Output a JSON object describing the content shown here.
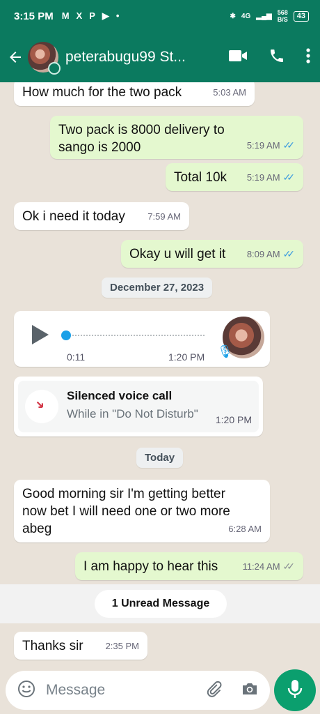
{
  "status_bar": {
    "time": "3:15 PM",
    "notification_icons": [
      "M",
      "X",
      "P",
      "▶",
      "•"
    ],
    "signal": "4G",
    "data_rate": "568",
    "data_unit": "B/S",
    "battery": "43"
  },
  "header": {
    "contact_name": "peterabugu99 St...",
    "icons": [
      "back-arrow-icon",
      "video-call-icon",
      "phone-icon",
      "more-vert-icon"
    ]
  },
  "messages": [
    {
      "direction": "in",
      "text": "How much for the two pack",
      "time": "5:03 AM"
    },
    {
      "direction": "out",
      "text": "Two pack is 8000 delivery to sango is 2000",
      "time": "5:19 AM",
      "read": true
    },
    {
      "direction": "out",
      "text": "Total 10k",
      "time": "5:19 AM",
      "read": true
    },
    {
      "direction": "in",
      "text": "Ok i need it today",
      "time": "7:59 AM"
    },
    {
      "direction": "out",
      "text": "Okay u will get it",
      "time": "8:09 AM",
      "read": true
    }
  ],
  "date_divider_1": "December 27, 2023",
  "voice_message": {
    "duration": "0:11",
    "time": "1:20 PM",
    "progress": 0.0
  },
  "call_event": {
    "title": "Silenced voice call",
    "subtitle": "While in \"Do Not Disturb\"",
    "time": "1:20 PM"
  },
  "date_divider_2": "Today",
  "messages_today": [
    {
      "direction": "in",
      "text": "Good morning sir I'm  getting better now bet I will need one or two more abeg",
      "time": "6:28 AM"
    },
    {
      "direction": "out",
      "text": "I am happy to hear this",
      "time": "11:24 AM",
      "read": false
    }
  ],
  "unread_label": "1 Unread Message",
  "unread_messages": [
    {
      "direction": "in",
      "text": "Thanks sir",
      "time": "2:35 PM"
    }
  ],
  "composer": {
    "placeholder": "Message"
  },
  "colors": {
    "header": "#0b7a5f",
    "outgoing_bubble": "#e4f8cf",
    "incoming_bubble": "#ffffff",
    "read_ticks": "#3b9be0",
    "mic_button": "#0b9f6e",
    "chat_bg": "#e9e2d9"
  }
}
